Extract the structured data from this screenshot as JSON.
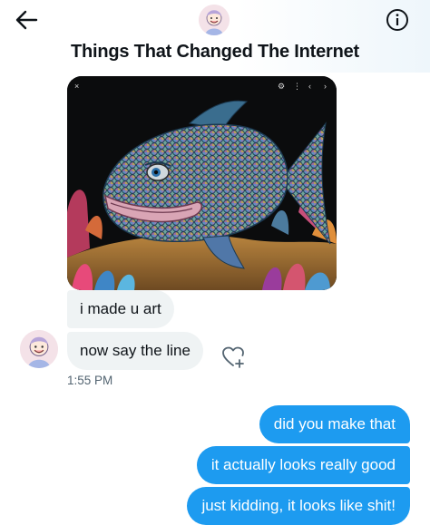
{
  "header": {
    "back_icon": "arrow-left-icon",
    "avatar_icon": "cartoon-avatar",
    "info_icon": "info-circle-icon",
    "title": "Things That Changed The Internet"
  },
  "media": {
    "description_icon": "fish-painting-image",
    "controls": {
      "close": "×",
      "more": "⋮",
      "prev": "‹",
      "next": "›"
    }
  },
  "messages": {
    "incoming": [
      {
        "text": "i made u art"
      },
      {
        "text": "now say the line"
      }
    ],
    "incoming_time": "1:55 PM",
    "outgoing": [
      {
        "text": "did you make that"
      },
      {
        "text": "it actually looks really good"
      },
      {
        "text": "just kidding, it looks like shit!"
      }
    ]
  },
  "colors": {
    "accent": "#1d9bf0",
    "incoming_bubble": "#eff3f4",
    "muted_text": "#536471"
  }
}
